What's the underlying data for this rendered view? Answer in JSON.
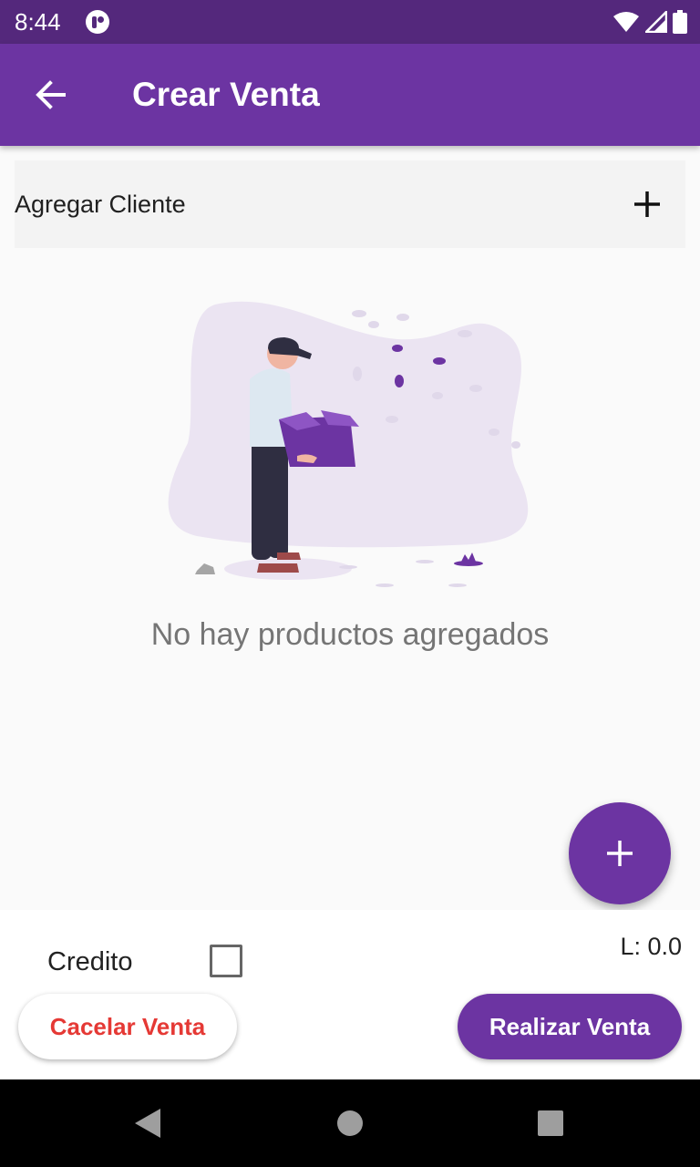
{
  "status_bar": {
    "time": "8:44",
    "icons": [
      "app-notification-icon",
      "wifi-icon",
      "signal-icon",
      "battery-icon"
    ]
  },
  "app_bar": {
    "title": "Crear Venta",
    "back_icon": "arrow-back-icon"
  },
  "client_row": {
    "label": "Agregar Cliente",
    "add_icon": "plus-icon"
  },
  "empty_state": {
    "message": "No hay productos agregados"
  },
  "fab": {
    "icon": "plus-icon"
  },
  "bottom_panel": {
    "credito_label": "Credito",
    "credito_checked": false,
    "total": "L: 0.0",
    "cancel_label": "Cacelar Venta",
    "submit_label": "Realizar Venta"
  },
  "nav_bar": {
    "icons": [
      "nav-back-icon",
      "nav-home-icon",
      "nav-recents-icon"
    ]
  },
  "colors": {
    "primary": "#6c34a2",
    "status_bar": "#54287c",
    "cancel_text": "#e53935",
    "background": "#fafafa"
  }
}
